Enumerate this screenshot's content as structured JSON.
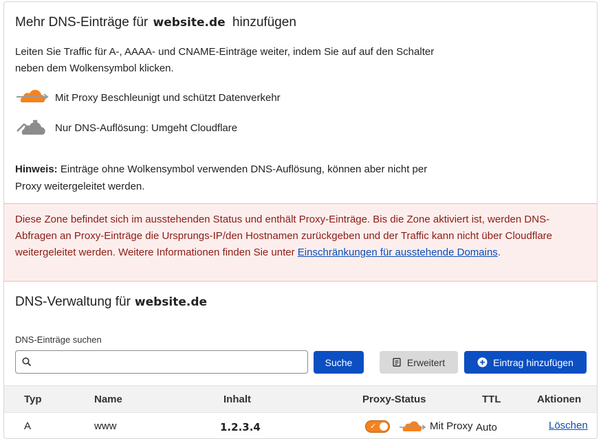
{
  "header": {
    "title_prefix": "Mehr DNS-Einträge für",
    "domain": "website.de",
    "title_suffix": "hinzufügen"
  },
  "intro": "Leiten Sie Traffic für A-, AAAA- und CNAME-Einträge weiter, indem Sie auf auf den Schalter neben dem Wolkensymbol klicken.",
  "legend": {
    "proxied": {
      "icon": "orange-cloud-proxied-icon",
      "text": "Mit Proxy Beschleunigt und schützt Datenverkehr",
      "color": "#f6821f"
    },
    "dns_only": {
      "icon": "gray-cloud-dns-only-icon",
      "text": "Nur DNS-Auflösung: Umgeht Cloudflare",
      "color": "#8c8c8c"
    }
  },
  "note": {
    "label": "Hinweis:",
    "text": " Einträge ohne Wolkensymbol verwenden DNS-Auflösung, können aber nicht per Proxy weitergeleitet werden."
  },
  "alert": {
    "text": "Diese Zone befindet sich im ausstehenden Status und enthält Proxy-Einträge. Bis die Zone aktiviert ist, werden DNS-Abfragen an Proxy-Einträge die Ursprungs-IP/den Hostnamen zurückgeben und der Traffic kann nicht über Cloudflare weitergeleitet werden. Weitere Informationen finden Sie unter ",
    "link": "Einschränkungen für ausstehende Domains",
    "suffix": "."
  },
  "dns_section": {
    "title": "DNS-Verwaltung für",
    "domain": "website.de"
  },
  "search": {
    "label": "DNS-Einträge suchen",
    "value": "",
    "placeholder": ""
  },
  "buttons": {
    "search": "Suche",
    "advanced": "Erweitert",
    "add": "Eintrag hinzufügen"
  },
  "table": {
    "headers": [
      "Typ",
      "Name",
      "Inhalt",
      "Proxy-Status",
      "TTL",
      "Aktionen"
    ],
    "rows": [
      {
        "type": "A",
        "name": "www",
        "content": "1.2.3.4",
        "proxy_status": "Mit Proxy",
        "proxy_on": true,
        "ttl": "Auto",
        "action": "Löschen"
      }
    ]
  },
  "colors": {
    "primary": "#0b4fc2",
    "proxy_orange": "#f6821f",
    "alert_bg": "#fdeeee",
    "alert_text": "#8b1c12"
  }
}
